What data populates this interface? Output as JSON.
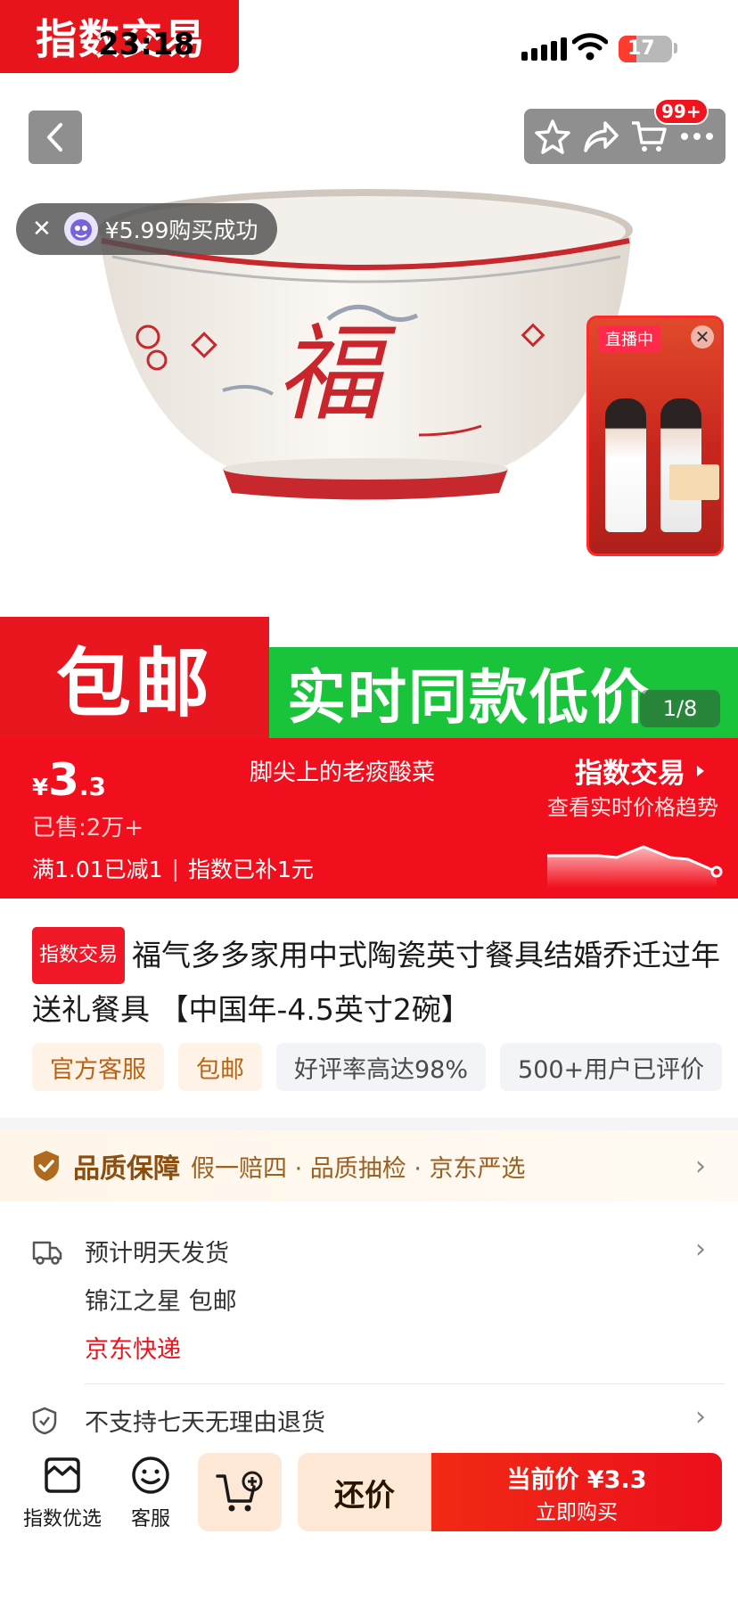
{
  "status_bar": {
    "brand": "指数交易",
    "time": "23:18",
    "battery": "17"
  },
  "hero": {
    "cart_badge": "99+",
    "toast": {
      "text": "¥5.99购买成功"
    },
    "live": {
      "tag": "直播中"
    },
    "page_counter": "1/8"
  },
  "promo": {
    "free_shipping": "包邮",
    "same_price": "实时同款低价"
  },
  "price_bar": {
    "currency": "¥",
    "price_int": "3",
    "price_dec": ".3",
    "shop_name": "脚尖上的老痰酸菜",
    "sold": "已售:2万+",
    "discount_a": "满1.01已减1",
    "discount_sep": "|",
    "discount_b": "指数已补1元",
    "index_title": "指数交易",
    "index_sub": "查看实时价格趋势"
  },
  "product": {
    "tag": "指数交易",
    "title": "福气多多家用中式陶瓷英寸餐具结婚乔迁过年送礼餐具 【中国年-4.5英寸2碗】",
    "chips": [
      "官方客服",
      "包邮",
      "好评率高达98%",
      "500+用户已评价"
    ]
  },
  "quality": {
    "title": "品质保障",
    "desc": "假一赔四 · 品质抽检 · 京东严选"
  },
  "shipping": {
    "eta": "预计明天发货",
    "origin": "锦江之星  包邮",
    "express": "京东快递"
  },
  "returns": {
    "text": "不支持七天无理由退货"
  },
  "bottom_bar": {
    "tab_home": "指数优选",
    "tab_service": "客服",
    "bargain": "还价",
    "buy_price": "当前价 ¥3.3",
    "buy_label": "立即购买"
  },
  "colors": {
    "brand_red": "#f20f1d",
    "promo_green": "#19c43a",
    "quality_brown": "#8a4f10"
  }
}
